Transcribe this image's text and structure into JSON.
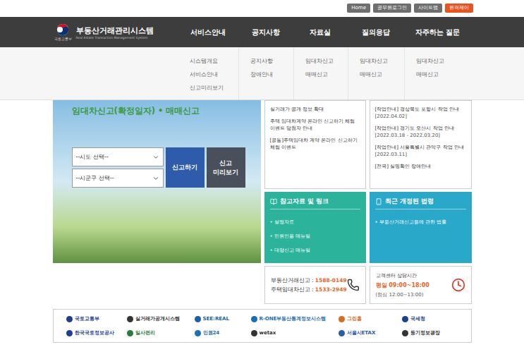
{
  "top_links": [
    {
      "label": "Home",
      "highlight": false
    },
    {
      "label": "공무원로그인",
      "highlight": false
    },
    {
      "label": "사이트맵",
      "highlight": false
    },
    {
      "label": "원격제어",
      "highlight": true
    }
  ],
  "logo": {
    "ministry": "국토교통부",
    "title": "부동산거래관리시스템",
    "subtitle": "Real Estate Transaction Management System"
  },
  "menu_open": true,
  "nav": [
    {
      "label": "서비스안내",
      "items": [
        "시스템개요",
        "서비스안내",
        "신고미리보기"
      ]
    },
    {
      "label": "공지사항",
      "items": [
        "공지사항",
        "장애안내"
      ]
    },
    {
      "label": "자료실",
      "items": [
        "임대차신고",
        "매매신고"
      ]
    },
    {
      "label": "질의응답",
      "items": [
        "임대차신고",
        "매매신고"
      ]
    },
    {
      "label": "자주하는 질문",
      "items": [
        "임대차신고",
        "매매신고"
      ]
    }
  ],
  "hero": {
    "title": "임대차신고(확정일자) • 매매신고",
    "selects": [
      "--시도 선택--",
      "--시군구 선택--"
    ],
    "buttons": [
      {
        "lines": [
          "신고하기"
        ],
        "kind": "primary"
      },
      {
        "lines": [
          "신고",
          "미리보기"
        ],
        "kind": "secondary"
      }
    ]
  },
  "notices": [
    "실거래가 공개 정보 확대",
    "주택 임대차계약 온라인 신고하기 체험 이벤트 당첨자 안내",
    "[공통]주택임대차 계약 온라인 신고하기 체험 이벤트"
  ],
  "work_notices": [
    {
      "title": "[작업안내] 경상북도 포항시 작업 안내",
      "date": "[2022.04.02]"
    },
    {
      "title": "[작업안내] 경기도 오산시 작업 안내",
      "date": "[2022.03.18 - 2022.03.20]"
    },
    {
      "title": "[작업안내] 서울특별시 관악구 작업 안내",
      "date": "[2022.03.11]"
    },
    {
      "title": "[전국] 실명확인 장애안내"
    }
  ],
  "links": {
    "title": "참고자료 및 링크",
    "items": [
      "설명자료",
      "민원인용 매뉴얼",
      "대량신고 매뉴얼"
    ]
  },
  "laws": {
    "title": "최근 개정된 법령",
    "items": [
      "부동산거래신고등에 관한 법률"
    ]
  },
  "contact": {
    "lines": [
      {
        "label": "부동산거래신고 : ",
        "number": "1588-0149"
      },
      {
        "label": "주택임대차신고 : ",
        "number": "1533-2949"
      }
    ],
    "hours": {
      "title": "고객센터 상담시간",
      "weekday": "평일 09:00~18:00",
      "lunch": "(점심 12:00~13:00)"
    }
  },
  "footer_logos": [
    {
      "label": "국토교통부",
      "color": "#1c3f94"
    },
    {
      "label": "실거래가공개시스템",
      "color": "#333333"
    },
    {
      "label": "SEE:REAL",
      "color": "#1a5fa8"
    },
    {
      "label": "R-ONE부동산통계정보시스템",
      "color": "#1a6eb5"
    },
    {
      "label": "그린홈",
      "color": "#e06a1b"
    },
    {
      "label": "국세청",
      "color": "#1c3f94"
    },
    {
      "label": "한국국토정보공사",
      "color": "#1c3f94"
    },
    {
      "label": "일사편리",
      "color": "#2a7a3a"
    },
    {
      "label": "민원24",
      "color": "#1f6db3"
    },
    {
      "label": "wetax",
      "color": "#333333"
    },
    {
      "label": "서울시ETAX",
      "color": "#2a5caa"
    },
    {
      "label": "등기정보광장",
      "color": "#333333"
    }
  ]
}
